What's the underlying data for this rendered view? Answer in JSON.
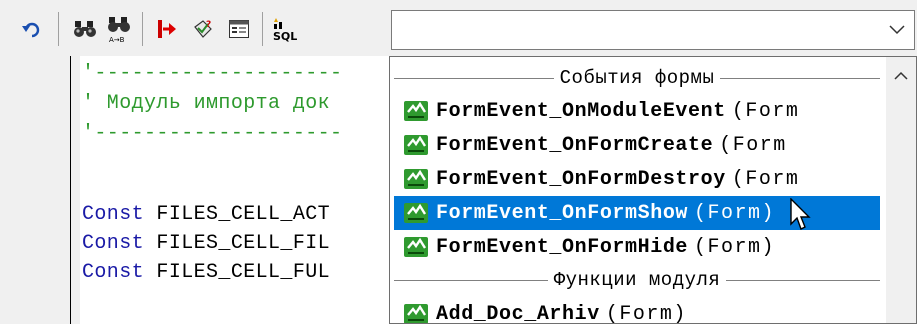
{
  "toolbar": {
    "buttons": [
      {
        "name": "undo-icon"
      },
      {
        "name": "find-icon"
      },
      {
        "name": "find-replace-icon"
      },
      {
        "name": "goto-icon"
      },
      {
        "name": "syntax-check-icon"
      },
      {
        "name": "form-view-icon"
      },
      {
        "name": "sql-icon",
        "label": "SQL"
      }
    ],
    "combo": {
      "value": "",
      "arrow_icon": "chevron-down-icon"
    }
  },
  "code_lines": [
    {
      "text": "'--------------------",
      "kind": "comment"
    },
    {
      "text": "' Модуль импорта док",
      "kind": "comment"
    },
    {
      "text": "'--------------------",
      "kind": "comment"
    },
    {
      "text": "",
      "kind": "blank"
    },
    {
      "kw": "Const",
      "rest": " FILES_CELL_ACT"
    },
    {
      "kw": "Const",
      "rest": " FILES_CELL_FIL"
    },
    {
      "kw": "Const",
      "rest": " FILES_CELL_FUL"
    }
  ],
  "dropdown": {
    "groups": [
      {
        "header": "События формы",
        "items": [
          {
            "name": "FormEvent_OnModuleEvent",
            "param": "(Form"
          },
          {
            "name": "FormEvent_OnFormCreate",
            "param": "(Form"
          },
          {
            "name": "FormEvent_OnFormDestroy",
            "param": "(Form"
          },
          {
            "name": "FormEvent_OnFormShow",
            "param": "(Form)",
            "selected": true
          },
          {
            "name": "FormEvent_OnFormHide",
            "param": "(Form)"
          }
        ]
      },
      {
        "header": "Функции модуля",
        "items": [
          {
            "name": "Add_Doc_Arhiv",
            "param": "(Form)"
          }
        ]
      }
    ]
  },
  "colors": {
    "selection": "#0078d7",
    "comment": "#2e9a2e",
    "keyword": "#1a1aa6"
  }
}
